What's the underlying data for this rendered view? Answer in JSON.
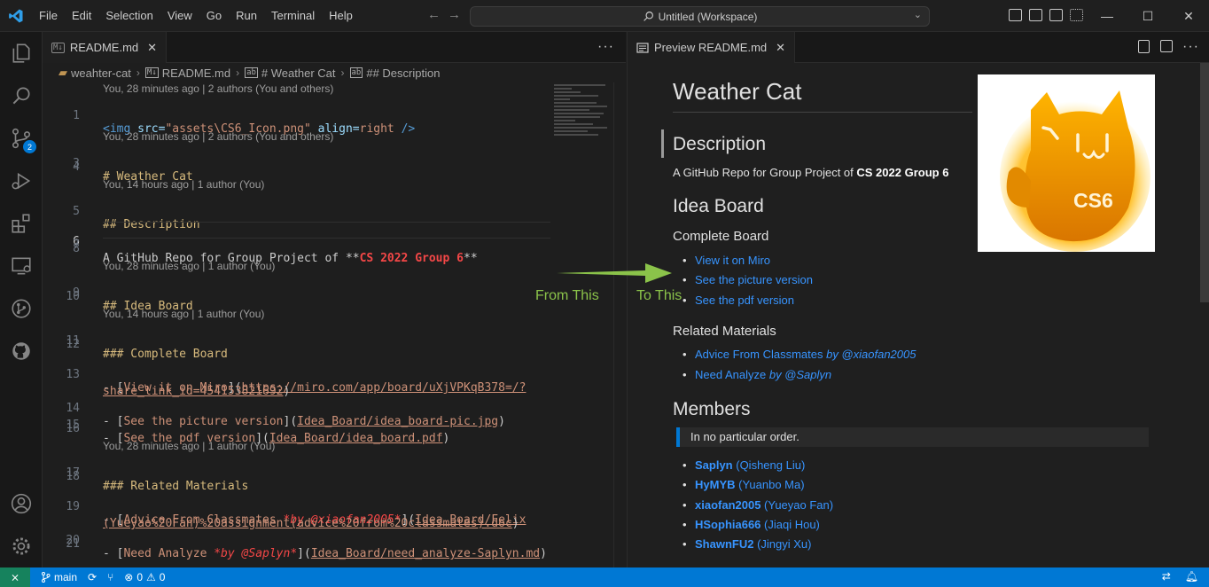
{
  "menu": [
    "File",
    "Edit",
    "Selection",
    "View",
    "Go",
    "Run",
    "Terminal",
    "Help"
  ],
  "command_center": "Untitled (Workspace)",
  "activity": {
    "scm_badge": "2"
  },
  "editor_left": {
    "tab_label": "README.md",
    "breadcrumb": [
      "weahter-cat",
      "README.md",
      "# Weather Cat",
      "## Description"
    ],
    "lens": {
      "l1": "You, 28 minutes ago | 2 authors (You and others)",
      "l3": "You, 28 minutes ago | 2 authors (You and others)",
      "l5": "You, 14 hours ago | 1 author (You)",
      "l9": "You, 28 minutes ago | 1 author (You)",
      "l11": "You, 14 hours ago | 1 author (You)",
      "l17": "You, 28 minutes ago | 1 author (You)"
    },
    "lines": {
      "n1": "1",
      "n3": "3",
      "n4": "4",
      "n5": "5",
      "n6": "6",
      "n7": "7",
      "n8": "8",
      "n9": "9",
      "n10": "10",
      "n11": "11",
      "n12": "12",
      "n13": "13",
      "n14": "14",
      "n15": "15",
      "n16": "16",
      "n17": "17",
      "n18": "18",
      "n19": "19",
      "n20": "20",
      "n21": "21"
    },
    "code": {
      "l1_tag": "<img",
      "l1_attr1": " src=",
      "l1_val1": "\"assets\\CS6_Icon.png\"",
      "l1_attr2": " align=",
      "l1_val2": "right",
      "l1_end": " />",
      "l3": "# Weather Cat",
      "l5": "## Description",
      "l7_a": "A GitHub Repo for Group Project of ",
      "l7_b": "**",
      "l7_c": "CS 2022 Group 6",
      "l7_d": "**",
      "l9": "## Idea Board",
      "l11": "### Complete Board",
      "l13_a": "- [",
      "l13_b": "View it on Miro",
      "l13_c": "](",
      "l13_d": "https://miro.com/app/board/uXjVPKqB378=/?",
      "l13w": "share_link_id=454153821692",
      "l13w_end": ")",
      "l14_a": "- [",
      "l14_b": "See the picture version",
      "l14_c": "](",
      "l14_d": "Idea_Board/idea_board-pic.jpg",
      "l14_e": ")",
      "l15_a": "- [",
      "l15_b": "See the pdf version",
      "l15_c": "](",
      "l15_d": "Idea_Board/idea_board.pdf",
      "l15_e": ")",
      "l17": "### Related Materials",
      "l19_a": "- [",
      "l19_b": "Advice From Classmates ",
      "l19_c": "*by @xiaofan2005*",
      "l19_d": "](",
      "l19_e": "Idea_Board/Felix",
      "l19w": "(Yueyao%20Fan)%20assignment(advice%20from%20classmates).doc",
      "l19w_end": ")",
      "l20_a": "- [",
      "l20_b": "Need Analyze ",
      "l20_c": "*by @Saplyn*",
      "l20_d": "](",
      "l20_e": "Idea_Board/need_analyze-Saplyn.md",
      "l20_f": ")"
    }
  },
  "editor_right": {
    "tab_label": "Preview README.md",
    "h1": "Weather Cat",
    "description_h": "Description",
    "description_text": "A GitHub Repo for Group Project of ",
    "description_bold": "CS 2022 Group 6",
    "idea_board_h": "Idea Board",
    "complete_board_h": "Complete Board",
    "complete_links": [
      "View it on Miro",
      "See the picture version",
      "See the pdf version"
    ],
    "related_h": "Related Materials",
    "related_links": [
      {
        "text": "Advice From Classmates ",
        "italic": "by @xiaofan2005"
      },
      {
        "text": "Need Analyze ",
        "italic": "by @Saplyn"
      }
    ],
    "members_h": "Members",
    "members_quote": "In no particular order.",
    "members": [
      {
        "handle": "Saplyn",
        "name": " (Qisheng Liu)"
      },
      {
        "handle": "HyMYB",
        "name": " (Yuanbo Ma)"
      },
      {
        "handle": "xiaofan2005",
        "name": " (Yueyao Fan)"
      },
      {
        "handle": "HSophia666",
        "name": " (Jiaqi Hou)"
      },
      {
        "handle": "ShawnFU2",
        "name": " (Jingyi Xu)"
      }
    ],
    "logo_text": "CS6"
  },
  "annotations": {
    "from": "From This",
    "to": "To This",
    "color": "#8bc34a"
  },
  "status": {
    "branch": "main",
    "errors": "0",
    "warnings": "0"
  },
  "colors": {
    "accent": "#0078d4",
    "remote": "#16825d",
    "link": "#3794ff"
  }
}
